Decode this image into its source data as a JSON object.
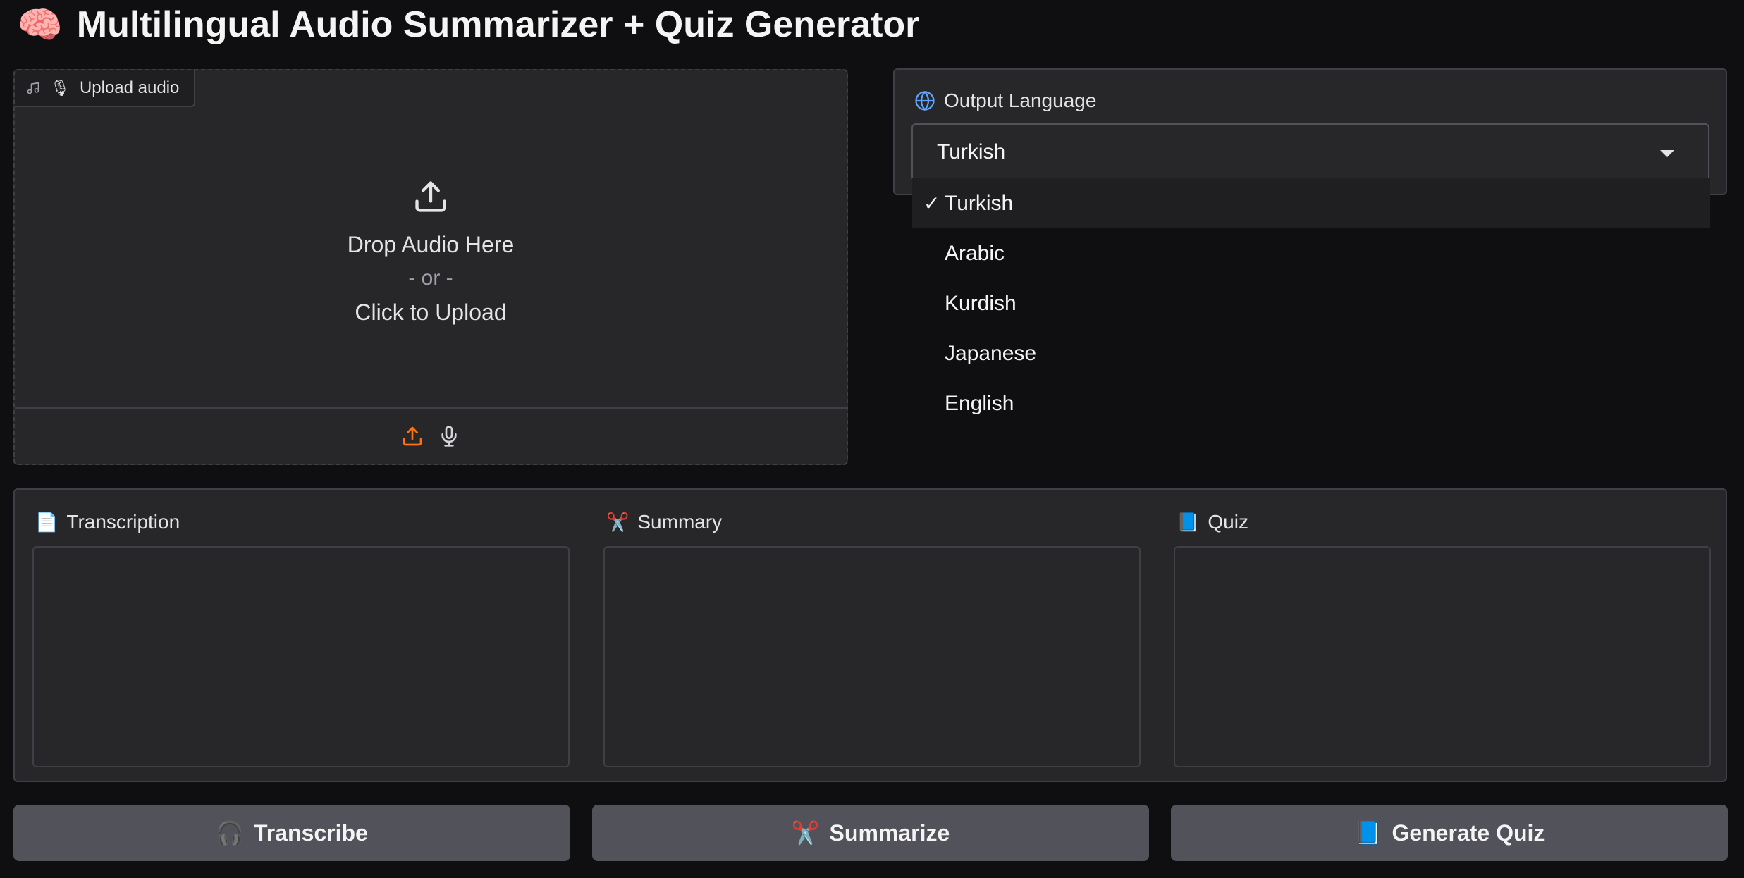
{
  "app": {
    "title": "Multilingual Audio Summarizer + Quiz Generator",
    "title_icon": "brain-icon",
    "title_emoji": "🧠"
  },
  "upload": {
    "tag_label": "Upload audio",
    "drop_text": "Drop Audio Here",
    "or_text": "- or -",
    "click_text": "Click to Upload",
    "accent_color": "#f97316"
  },
  "language": {
    "label": "Output Language",
    "selected": "Turkish",
    "options": [
      {
        "label": "Turkish",
        "selected": true
      },
      {
        "label": "Arabic",
        "selected": false
      },
      {
        "label": "Kurdish",
        "selected": false
      },
      {
        "label": "Japanese",
        "selected": false
      },
      {
        "label": "English",
        "selected": false
      }
    ],
    "check_mark": "✓"
  },
  "outputs": {
    "transcription": {
      "label": "Transcription",
      "emoji": "📄",
      "value": ""
    },
    "summary": {
      "label": "Summary",
      "emoji": "✂️",
      "value": ""
    },
    "quiz": {
      "label": "Quiz",
      "emoji": "📘",
      "value": ""
    }
  },
  "buttons": {
    "transcribe": {
      "label": "Transcribe",
      "emoji": "🎧"
    },
    "summarize": {
      "label": "Summarize",
      "emoji": "✂️"
    },
    "generate_quiz": {
      "label": "Generate Quiz",
      "emoji": "📘"
    }
  }
}
